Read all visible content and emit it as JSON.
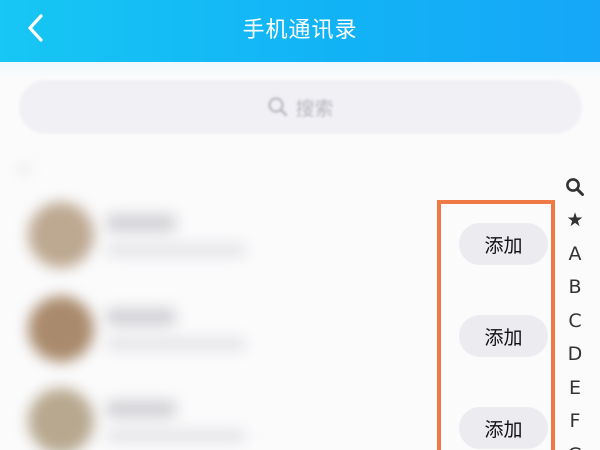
{
  "header": {
    "title": "手机通讯录",
    "back_icon": "chevron-left-icon",
    "background_color": "#12b3f6"
  },
  "search": {
    "placeholder": "搜索",
    "icon": "search-icon"
  },
  "contacts": [
    {
      "action_label": "添加"
    },
    {
      "action_label": "添加"
    },
    {
      "action_label": "添加"
    }
  ],
  "index_bar": {
    "items": [
      "search-icon",
      "★",
      "A",
      "B",
      "C",
      "D",
      "E",
      "F",
      "G"
    ]
  },
  "colors": {
    "highlight": "#f07a45",
    "button_bg": "#ebebf0"
  }
}
